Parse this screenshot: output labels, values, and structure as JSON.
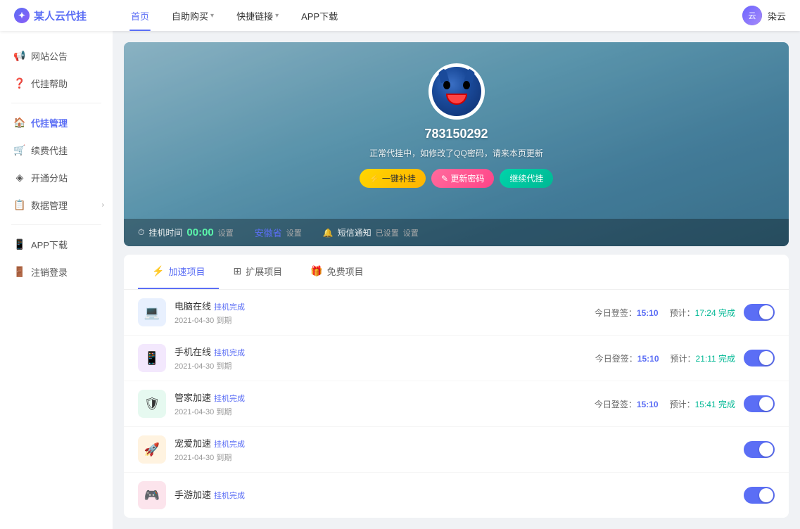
{
  "header": {
    "logo_text": "某人云代挂",
    "nav": [
      {
        "label": "首页",
        "active": true,
        "has_arrow": false
      },
      {
        "label": "自助购买",
        "active": false,
        "has_arrow": true
      },
      {
        "label": "快捷链接",
        "active": false,
        "has_arrow": true
      },
      {
        "label": "APP下载",
        "active": false,
        "has_arrow": false
      }
    ],
    "user_name": "染云"
  },
  "sidebar": {
    "sections": [
      {
        "items": [
          {
            "id": "announcement",
            "label": "网站公告",
            "icon": "megaphone"
          },
          {
            "id": "help",
            "label": "代挂帮助",
            "icon": "help"
          }
        ]
      },
      {
        "divider": true,
        "items": [
          {
            "id": "manage",
            "label": "代挂管理",
            "icon": "manage",
            "active": true
          },
          {
            "id": "renew",
            "label": "续费代挂",
            "icon": "renew"
          },
          {
            "id": "branch",
            "label": "开通分站",
            "icon": "branch"
          },
          {
            "id": "data",
            "label": "数据管理",
            "icon": "data",
            "has_expand": true
          }
        ]
      },
      {
        "divider": true,
        "items": [
          {
            "id": "app",
            "label": "APP下载",
            "icon": "app"
          },
          {
            "id": "logout",
            "label": "注销登录",
            "icon": "logout"
          }
        ]
      }
    ]
  },
  "profile": {
    "user_id": "783150292",
    "status_text": "正常代挂中，如修改了QQ密码，请来本页更新",
    "btn_renew": "⚡ 一键补挂",
    "btn_change": "✎ 更新密码",
    "btn_continue": "继续代挂",
    "time_label": "挂机时间",
    "time_value": "00:00",
    "time_set": "设置",
    "province": "安徽省",
    "province_set": "设置",
    "notify_label": "短信通知",
    "notify_value": "已设置",
    "notify_set": "设置"
  },
  "tabs": [
    {
      "id": "boost",
      "label": "加速项目",
      "icon": "⚡",
      "active": true
    },
    {
      "id": "extend",
      "label": "扩展项目",
      "icon": "⊞",
      "active": false
    },
    {
      "id": "free",
      "label": "免费项目",
      "icon": "🎁",
      "active": false
    }
  ],
  "items": [
    {
      "id": "pc-online",
      "title": "电脑在线",
      "status": "挂机完成",
      "date": "2021-04-30 到期",
      "today": "今日登签：15:10",
      "today_val": "15:10",
      "predict": "预计：17:24 完成",
      "predict_val": "17:24",
      "icon_type": "blue",
      "icon": "computer",
      "enabled": true
    },
    {
      "id": "mobile-online",
      "title": "手机在线",
      "status": "挂机完成",
      "date": "2021-04-30 到期",
      "today": "今日登签：15:10",
      "today_val": "15:10",
      "predict": "预计：21:11 完成",
      "predict_val": "21:11",
      "icon_type": "purple",
      "icon": "phone",
      "enabled": true
    },
    {
      "id": "guardian-boost",
      "title": "管家加速",
      "status": "挂机完成",
      "date": "2021-04-30 到期",
      "today": "今日登签：15:10",
      "today_val": "15:10",
      "predict": "预计：15:41 完成",
      "predict_val": "15:41",
      "icon_type": "green",
      "icon": "shield",
      "enabled": true
    },
    {
      "id": "pet-boost",
      "title": "宠爱加速",
      "status": "挂机完成",
      "date": "2021-04-30 到期",
      "today": "",
      "today_val": "",
      "predict": "",
      "predict_val": "",
      "icon_type": "orange",
      "icon": "rocket",
      "enabled": true
    },
    {
      "id": "mobile-game",
      "title": "手游加速",
      "status": "挂机完成",
      "date": "",
      "today": "",
      "today_val": "",
      "predict": "",
      "predict_val": "",
      "icon_type": "pink",
      "icon": "game",
      "enabled": true
    }
  ]
}
